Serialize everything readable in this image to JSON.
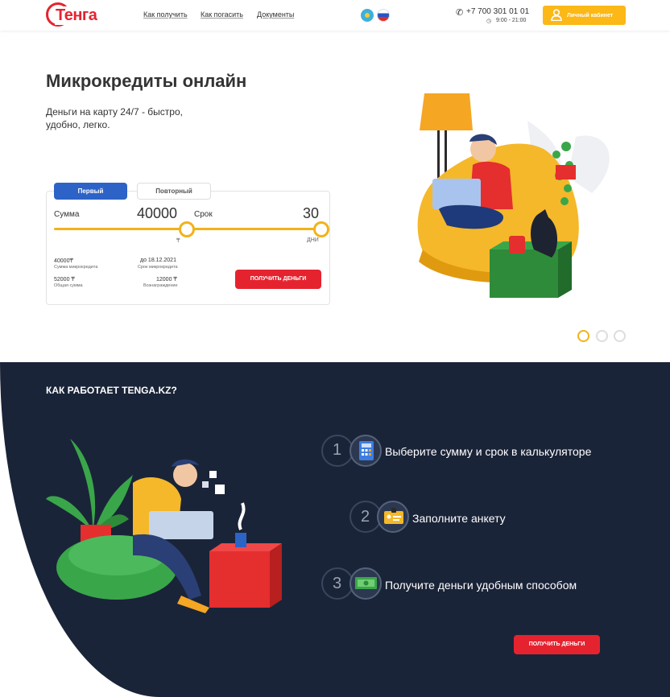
{
  "header": {
    "logo_text": "Тенга",
    "nav": [
      "Как получить",
      "Как погасить",
      "Документы"
    ],
    "phone": "+7 700 301 01 01",
    "hours": "9:00 - 21:00",
    "cabinet_label": "Личный кабинет"
  },
  "hero": {
    "title": "Микрокредиты онлайн",
    "subtitle": "Деньги на карту 24/7 - быстро, удобно, легко."
  },
  "calculator": {
    "tabs": {
      "first": "Первый",
      "repeat": "Повторный"
    },
    "amount_label": "Сумма",
    "amount_value": "40000",
    "amount_unit": "₸",
    "term_label": "Срок",
    "term_value": "30",
    "term_unit": "ДНИ",
    "summary": {
      "loan_amount": "40000₸",
      "loan_amount_caption": "Сумма микрокредита",
      "due_date": "до 18.12.2021",
      "due_date_caption": "Срок микрокредита",
      "total": "52000 ₸",
      "total_caption": "Общая сумма",
      "fee": "12000 ₸",
      "fee_caption": "Вознаграждение"
    },
    "button_label": "ПОЛУЧИТЬ ДЕНЬГИ"
  },
  "how": {
    "title": "КАК РАБОТАЕТ TENGA.KZ?",
    "steps": [
      {
        "num": "1",
        "text": "Выберите сумму и срок в калькуляторе",
        "icon": "calculator-icon"
      },
      {
        "num": "2",
        "text": "Заполните анкету",
        "icon": "id-card-icon"
      },
      {
        "num": "3",
        "text": "Получите деньги удобным способом",
        "icon": "cash-icon"
      }
    ],
    "button_label": "ПОЛУЧИТЬ ДЕНЬГИ"
  },
  "colors": {
    "brand_red": "#e5232f",
    "accent_yellow": "#f2b21b",
    "tab_blue": "#2d63c7",
    "dark_bg": "#1a2438"
  }
}
